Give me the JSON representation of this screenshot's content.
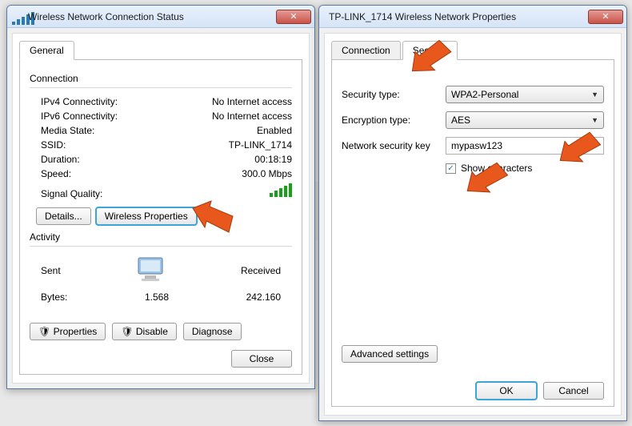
{
  "left": {
    "title": "Wireless Network Connection Status",
    "tab_general": "General",
    "group_connection": "Connection",
    "rows": {
      "ipv4_k": "IPv4 Connectivity:",
      "ipv4_v": "No Internet access",
      "ipv6_k": "IPv6 Connectivity:",
      "ipv6_v": "No Internet access",
      "media_k": "Media State:",
      "media_v": "Enabled",
      "ssid_k": "SSID:",
      "ssid_v": "TP-LINK_1714",
      "dur_k": "Duration:",
      "dur_v": "00:18:19",
      "speed_k": "Speed:",
      "speed_v": "300.0 Mbps",
      "sigq_k": "Signal Quality:"
    },
    "btn_details": "Details...",
    "btn_wprops": "Wireless Properties",
    "group_activity": "Activity",
    "sent_label": "Sent",
    "recv_label": "Received",
    "bytes_label": "Bytes:",
    "bytes_sent": "1.568",
    "bytes_recv": "242.160",
    "btn_props": "Properties",
    "btn_disable": "Disable",
    "btn_diag": "Diagnose",
    "btn_close": "Close"
  },
  "right": {
    "title": "TP-LINK_1714 Wireless Network Properties",
    "tab_conn": "Connection",
    "tab_sec": "Security",
    "sec_type_k": "Security type:",
    "sec_type_v": "WPA2-Personal",
    "enc_k": "Encryption type:",
    "enc_v": "AES",
    "key_k": "Network security key",
    "key_v": "mypasw123",
    "show_chars": "Show characters",
    "btn_adv": "Advanced settings",
    "btn_ok": "OK",
    "btn_cancel": "Cancel"
  }
}
